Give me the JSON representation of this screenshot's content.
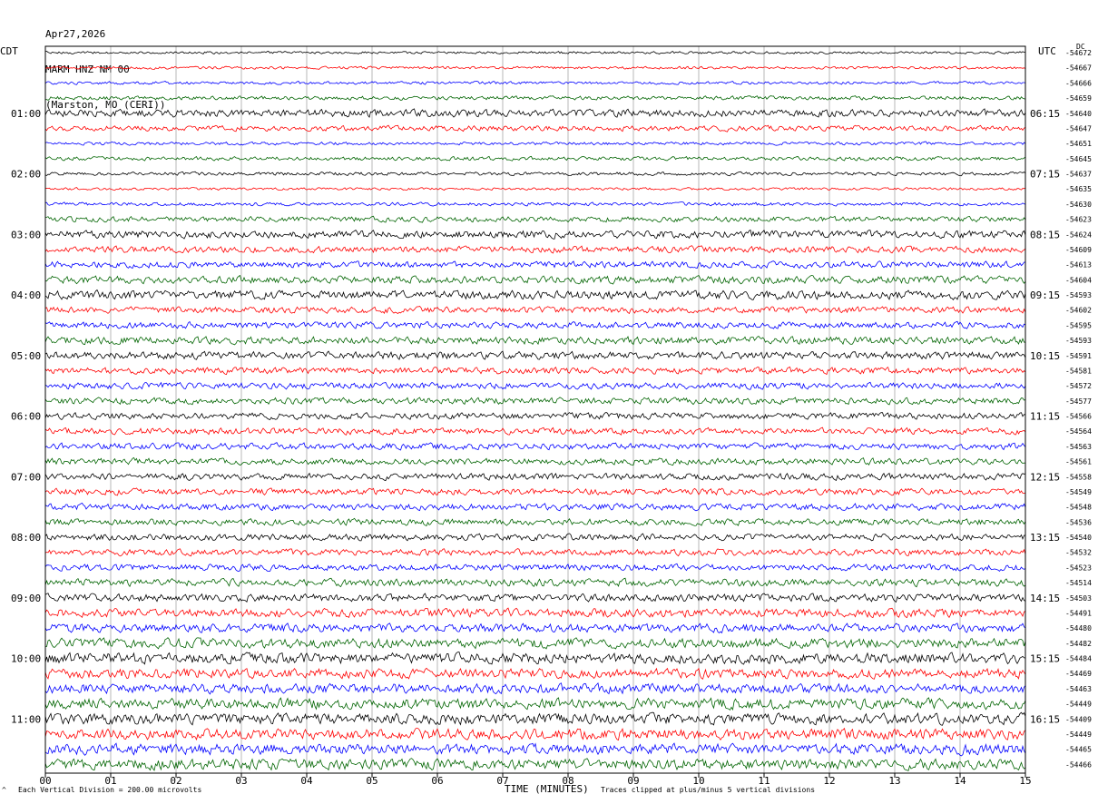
{
  "header": {
    "date": "Apr27,2026",
    "station": "MARM HNZ NM 00",
    "location": "(Marston, MO (CERI))"
  },
  "left_label": "CDT",
  "right_label": "UTC",
  "dc_label": "DC",
  "footer": {
    "left": "Each Vertical Division = 200.00 microvolts",
    "center": "TIME (MINUTES)",
    "right": "Traces clipped at plus/minus 5 vertical divisions",
    "corner": "^"
  },
  "chart_data": {
    "type": "line",
    "title": "",
    "xlabel": "TIME (MINUTES)",
    "xlim": [
      0,
      15
    ],
    "x_ticks": [
      "00",
      "01",
      "02",
      "03",
      "04",
      "05",
      "06",
      "07",
      "08",
      "09",
      "10",
      "11",
      "12",
      "13",
      "14",
      "15"
    ],
    "trace_colors": [
      "#000000",
      "#ff0000",
      "#0000ff",
      "#006400"
    ],
    "trace_count": 48,
    "minutes_per_trace": 15,
    "cdt_hour_labels": [
      "01:00",
      "02:00",
      "03:00",
      "04:00",
      "05:00",
      "06:00",
      "07:00",
      "08:00",
      "09:00",
      "10:00",
      "11:00"
    ],
    "utc_hour_labels": [
      "06:15",
      "07:15",
      "08:15",
      "09:15",
      "10:15",
      "11:15",
      "12:15",
      "13:15",
      "14:15",
      "15:15",
      "16:15"
    ],
    "dc_offsets": [
      -54672,
      -54667,
      -54666,
      -54659,
      -54640,
      -54647,
      -54651,
      -54645,
      -54637,
      -54635,
      -54630,
      -54623,
      -54624,
      -54609,
      -54613,
      -54604,
      -54593,
      -54602,
      -54595,
      -54593,
      -54591,
      -54581,
      -54572,
      -54577,
      -54566,
      -54564,
      -54563,
      -54561,
      -54558,
      -54549,
      -54548,
      -54536,
      -54540,
      -54532,
      -54523,
      -54514,
      -54503,
      -54491,
      -54480,
      -54482,
      -54484,
      -54469,
      -54463,
      -54449,
      -54409,
      -54449,
      -54465,
      -54466
    ],
    "trace_amplitude": [
      1.2,
      1.3,
      1.4,
      1.8,
      3.5,
      2.5,
      1.5,
      1.8,
      1.6,
      1.2,
      1.6,
      2.5,
      3.5,
      3,
      3,
      3.5,
      4,
      3,
      3,
      3.5,
      3.5,
      3,
      3,
      3,
      3,
      3,
      3,
      3,
      3,
      3,
      3,
      3,
      3,
      3,
      3,
      3.5,
      3.5,
      4,
      4,
      4.5,
      5,
      4.5,
      4.5,
      5,
      5,
      5,
      5,
      5
    ]
  }
}
